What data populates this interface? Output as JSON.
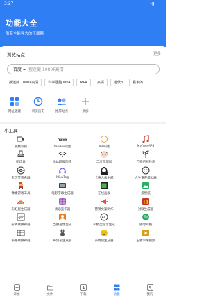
{
  "status_bar": {
    "time": "3:27",
    "right": "▾▮"
  },
  "header": {
    "title": "功能大全",
    "subtitle": "隐蔽全能强大的下载器"
  },
  "browse": {
    "title": "浏览站点",
    "more": "更多",
    "search": {
      "engine": "百度",
      "placeholder": "搜迷藏 1080P高清"
    },
    "hotwords": [
      "搜迷藏 1080P高清",
      "科学怪胎 MP4",
      "MP4",
      "高清",
      "潜伏3",
      "看車的"
    ],
    "quick": [
      {
        "label": "网址收藏",
        "icon": "bookmark-grid-icon"
      },
      {
        "label": "浏览历史",
        "icon": "history-icon"
      },
      {
        "label": "推荐站点",
        "icon": "recommend-sites-icon"
      },
      {
        "label": "添加",
        "icon": "plus-icon"
      }
    ]
  },
  "tools": {
    "title": "小工具",
    "items": [
      {
        "label": "视频识别",
        "icon": "video-recognition-icon"
      },
      {
        "label": "Yandex识图",
        "icon": "yandex-icon"
      },
      {
        "label": "360识图",
        "icon": "image-360-icon"
      },
      {
        "label": "MyfreeMP3",
        "icon": "music-note-icon"
      },
      {
        "label": "图印章",
        "icon": "stamp-icon"
      },
      {
        "label": "B站超级直转",
        "icon": "wifi-icon"
      },
      {
        "label": "二次元测试",
        "icon": "anime-face-icon"
      },
      {
        "label": "万物识别检测",
        "icon": "plant-icon"
      },
      {
        "label": "宝可梦宗名器",
        "icon": "pokeball-icon"
      },
      {
        "label": "MikuTog",
        "icon": "headphones-icon"
      },
      {
        "label": "卡通人像生成",
        "icon": "cartoon-portrait-icon"
      },
      {
        "label": "人生重开模拟器",
        "icon": "restart-life-icon"
      },
      {
        "label": "像素游戏工具",
        "icon": "pixel-game-icon"
      },
      {
        "label": "电影字幕生成器",
        "icon": "film-icon"
      },
      {
        "label": "在线画板",
        "icon": "drawing-board-icon"
      },
      {
        "label": "爱壁纸",
        "icon": "wallpaper-icon"
      },
      {
        "label": "彩虹屁生成器",
        "icon": "rainbow-icon"
      },
      {
        "label": "场话鉴识器",
        "icon": "grid-app-icon"
      },
      {
        "label": "营销文案制作",
        "icon": "megaphone-icon"
      },
      {
        "label": "对联生成器",
        "icon": "couplet-icon"
      },
      {
        "label": "形式转换神器",
        "icon": "convert-icon"
      },
      {
        "label": "当换画像生成",
        "icon": "avatar-maker-icon"
      },
      {
        "label": "AI模型提示生成",
        "icon": "ai-icon"
      },
      {
        "label": "随时对换",
        "icon": "chat-icon"
      },
      {
        "label": "表格转换神器",
        "icon": "table-convert-icon"
      },
      {
        "label": "奇兔子生成器",
        "icon": "rabbit-icon"
      },
      {
        "label": "表情包生成器",
        "icon": "emoji-icon"
      },
      {
        "label": "王者荣耀视频",
        "icon": "game-video-icon"
      }
    ]
  },
  "bottom_nav": [
    {
      "label": "添加",
      "icon": "add-box-icon",
      "active": false
    },
    {
      "label": "文件",
      "icon": "folder-icon",
      "active": false
    },
    {
      "label": "下载",
      "icon": "download-icon",
      "active": false
    },
    {
      "label": "功能",
      "icon": "apps-icon",
      "active": true
    },
    {
      "label": "我的",
      "icon": "profile-icon",
      "active": false
    }
  ],
  "colors": {
    "accent": "#2f7ef3",
    "header_bg": "#2f7ef3"
  }
}
